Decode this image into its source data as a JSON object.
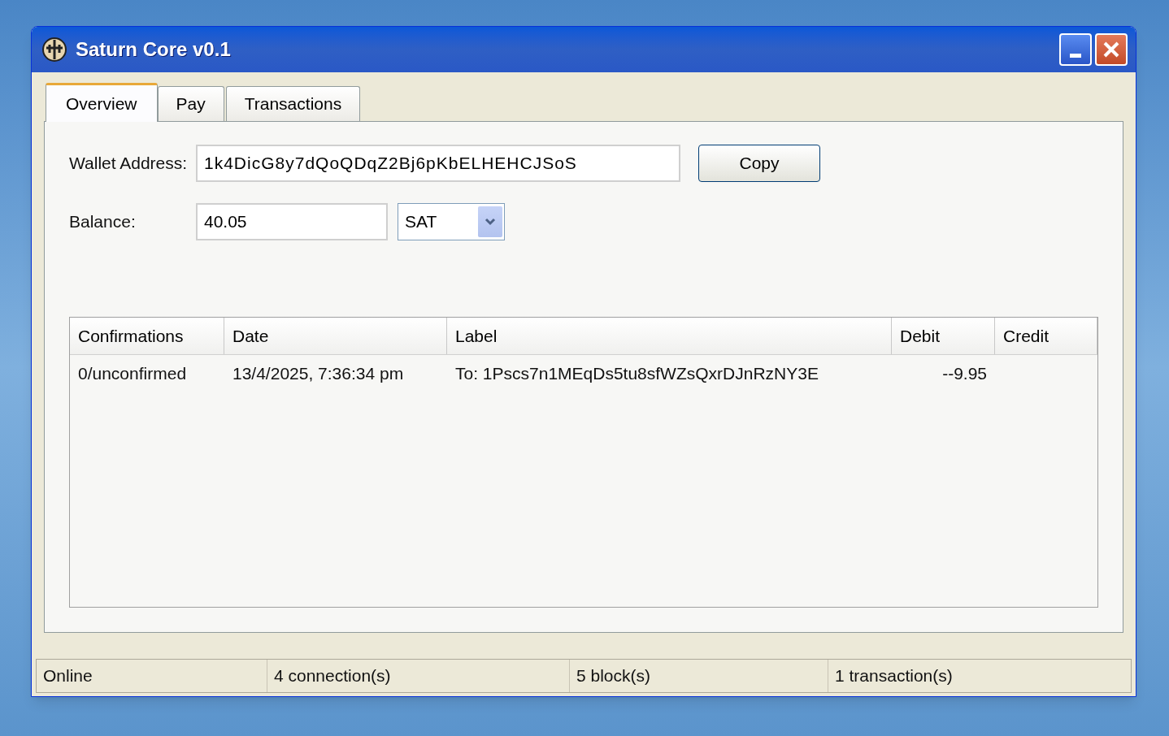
{
  "window": {
    "title": "Saturn Core v0.1"
  },
  "tabs": [
    {
      "label": "Overview",
      "selected": true
    },
    {
      "label": "Pay",
      "selected": false
    },
    {
      "label": "Transactions",
      "selected": false
    }
  ],
  "wallet_address": {
    "label": "Wallet Address:",
    "value": "1k4DicG8y7dQoQDqZ2Bj6pKbELHEHCJSoS",
    "copy_button": "Copy"
  },
  "balance": {
    "label": "Balance:",
    "value": "40.05",
    "unit": "SAT"
  },
  "table": {
    "columns": [
      "Confirmations",
      "Date",
      "Label",
      "Debit",
      "Credit"
    ],
    "rows": [
      {
        "confirmations": "0/unconfirmed",
        "date": "13/4/2025, 7:36:34 pm",
        "label": "To: 1Pscs7n1MEqDs5tu8sfWZsQxrDJnRzNY3E",
        "debit": "--9.95",
        "credit": ""
      }
    ]
  },
  "status_bar": [
    "Online",
    "4 connection(s)",
    "5 block(s)",
    "1 transaction(s)"
  ]
}
